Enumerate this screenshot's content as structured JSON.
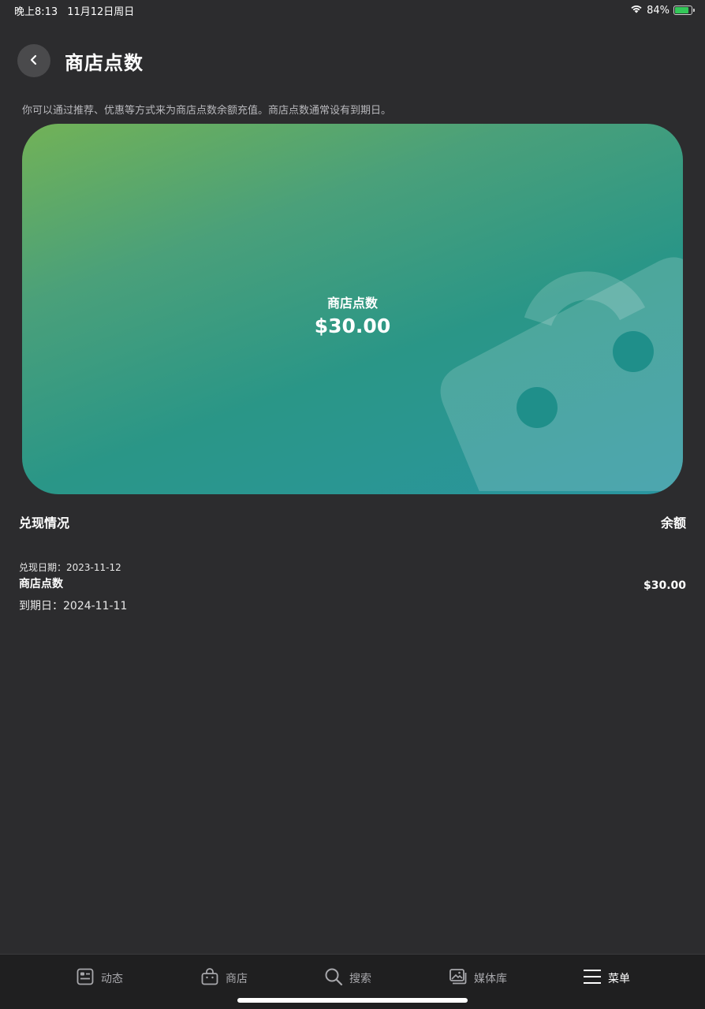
{
  "status": {
    "time": "晚上8:13",
    "date": "11月12日周日",
    "battery": "84%",
    "battery_level": 0.84
  },
  "header": {
    "title": "商店点数"
  },
  "description": "你可以通过推荐、优惠等方式来为商店点数余额充值。商店点数通常设有到期日。",
  "card": {
    "label": "商店点数",
    "amount": "$30.00"
  },
  "section": {
    "title": "兑现情况",
    "balance_label": "余额"
  },
  "records": [
    {
      "redeem_date": "兑现日期：2023-11-12",
      "name": "商店点数",
      "expiry": "到期日：2024-11-11",
      "amount": "$30.00"
    }
  ],
  "tabs": [
    {
      "label": "动态",
      "icon": "news-feed-icon"
    },
    {
      "label": "商店",
      "icon": "shopping-bag-icon"
    },
    {
      "label": "搜索",
      "icon": "search-icon"
    },
    {
      "label": "媒体库",
      "icon": "media-library-icon"
    },
    {
      "label": "菜单",
      "icon": "menu-icon",
      "active": true
    }
  ],
  "colors": {
    "background": "#2c2c2e",
    "card_gradient_start": "#72b257",
    "card_gradient_end": "#2a95a0",
    "battery": "#34c759"
  }
}
